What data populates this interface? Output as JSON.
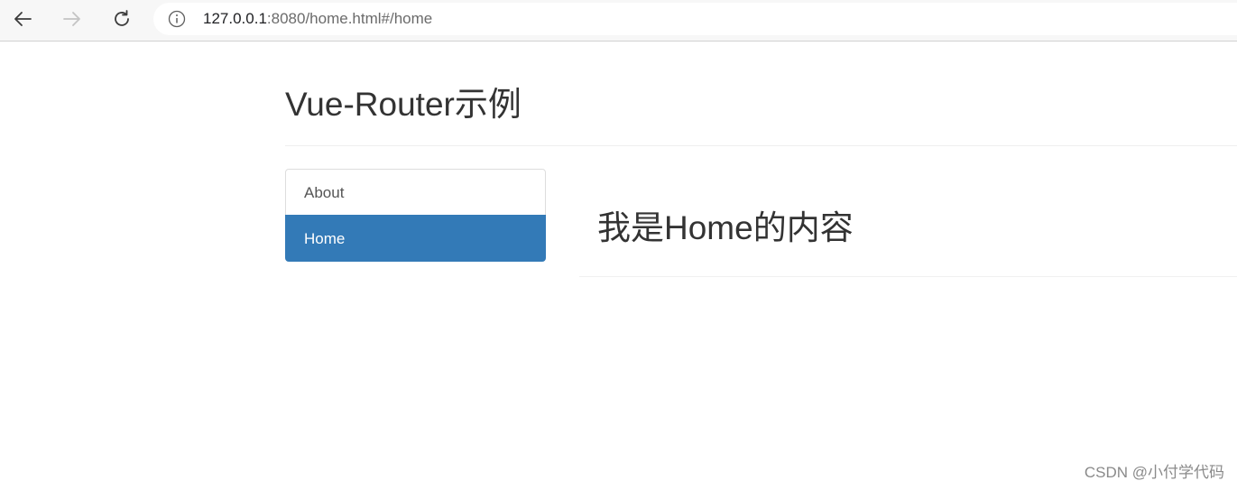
{
  "browser": {
    "url_host": "127.0.0.1",
    "url_rest": ":8080/home.html#/home",
    "icons": {
      "back": "back-arrow-icon",
      "forward": "forward-arrow-icon",
      "reload": "reload-icon",
      "info": "info-icon"
    }
  },
  "page": {
    "title": "Vue-Router示例",
    "nav": {
      "items": [
        {
          "label": "About",
          "active": false
        },
        {
          "label": "Home",
          "active": true
        }
      ]
    },
    "content": {
      "heading": "我是Home的内容"
    }
  },
  "watermark": "CSDN @小付学代码",
  "colors": {
    "active_bg": "#337ab7",
    "active_text": "#ffffff",
    "text": "#333333"
  }
}
